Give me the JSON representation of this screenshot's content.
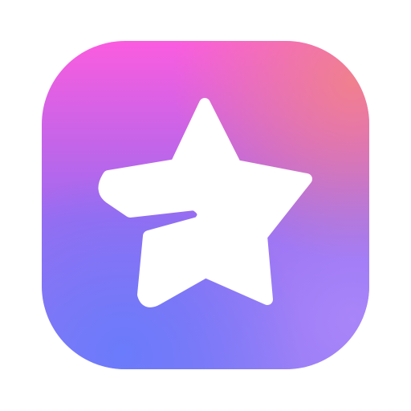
{
  "app_icon": {
    "icon": "star-icon",
    "background_gradient": {
      "pink": "#FB5CDF",
      "coral": "#F0808E",
      "violet": "#9B6BF0",
      "blue": "#6A7BFB",
      "lavender": "#A985F9"
    },
    "star_color": "#FFFFFF"
  }
}
